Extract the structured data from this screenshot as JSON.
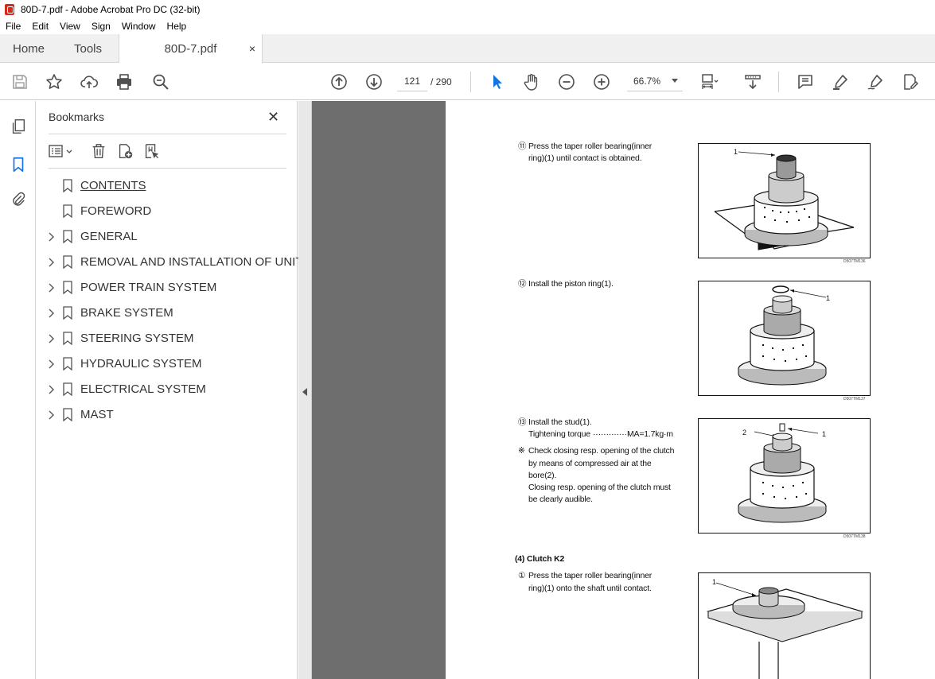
{
  "window": {
    "title": "80D-7.pdf - Adobe Acrobat Pro DC (32-bit)"
  },
  "menu": [
    "File",
    "Edit",
    "View",
    "Sign",
    "Window",
    "Help"
  ],
  "tabs": {
    "home": "Home",
    "tools": "Tools",
    "document": "80D-7.pdf",
    "close_glyph": "×"
  },
  "toolbar": {
    "current_page": "121",
    "total_pages": "/ 290",
    "zoom": "66.7%"
  },
  "bookmarks": {
    "title": "Bookmarks",
    "close_glyph": "✕",
    "items": [
      {
        "label": "CONTENTS",
        "expandable": false
      },
      {
        "label": "FOREWORD",
        "expandable": false
      },
      {
        "label": "GENERAL",
        "expandable": true
      },
      {
        "label": "REMOVAL AND INSTALLATION OF UNIT",
        "expandable": true
      },
      {
        "label": "POWER TRAIN SYSTEM",
        "expandable": true
      },
      {
        "label": "BRAKE SYSTEM",
        "expandable": true
      },
      {
        "label": "STEERING SYSTEM",
        "expandable": true
      },
      {
        "label": "HYDRAULIC SYSTEM",
        "expandable": true
      },
      {
        "label": "ELECTRICAL SYSTEM",
        "expandable": true
      },
      {
        "label": "MAST",
        "expandable": true
      }
    ]
  },
  "document": {
    "step11": {
      "num": "⑪",
      "line1": "Press the taper roller bearing(inner",
      "line2": "ring)(1) until contact is obtained.",
      "fig_label": "1",
      "fig_code": "D507TM136"
    },
    "step12": {
      "num": "⑫",
      "line1": "Install the piston ring(1).",
      "fig_label": "1",
      "fig_code": "D507TM137"
    },
    "step13": {
      "num": "⑬",
      "line1": "Install the stud(1).",
      "torque_label": "Tightening torque",
      "torque_dots": "··············",
      "torque_value": "MA=1.7kg·m",
      "note_mark": "※",
      "note1": "Check closing resp.  opening of the clutch",
      "note2": "by means of compressed air at the",
      "note3": "bore(2).",
      "note4": "Closing resp.  opening of the clutch must",
      "note5": "be clearly audible.",
      "fig_label1": "1",
      "fig_label2": "2",
      "fig_code": "D507TM138"
    },
    "section": "(4) Clutch K2",
    "step1": {
      "num": "①",
      "line1": "Press the taper roller bearing(inner",
      "line2": "ring)(1) onto the shaft until contact.",
      "fig_label": "1"
    }
  }
}
